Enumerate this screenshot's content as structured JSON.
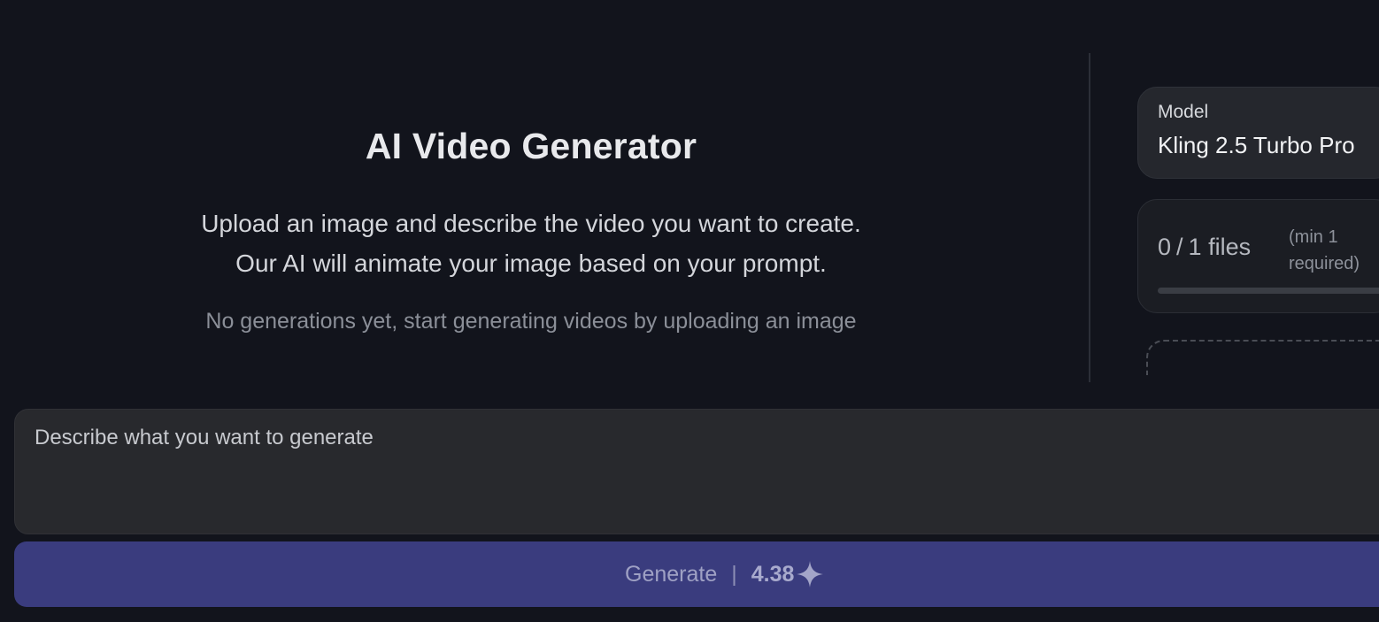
{
  "hero": {
    "title": "AI Video Generator",
    "description_line1": "Upload an image and describe the video you want to create.",
    "description_line2": "Our AI will animate your image based on your prompt.",
    "empty_state": "No generations yet, start generating videos by uploading an image"
  },
  "model": {
    "label": "Model",
    "value": "Kling 2.5 Turbo Pro"
  },
  "files": {
    "count": "0",
    "separator": "/",
    "max": "1",
    "unit": "files",
    "requirement_line1": "(min 1",
    "requirement_line2": "required)",
    "progress_fraction": 0
  },
  "prompt": {
    "placeholder": "Describe what you want to generate",
    "value": ""
  },
  "generate": {
    "label": "Generate",
    "separator": "|",
    "cost": "4.38",
    "icon": "sparkle-icon"
  },
  "colors": {
    "background": "#12141c",
    "accent_button": "#3a3c7e",
    "card": "#25272d"
  }
}
